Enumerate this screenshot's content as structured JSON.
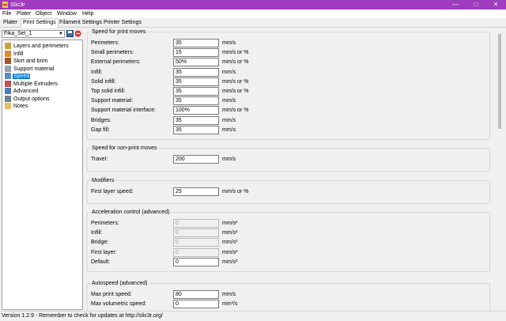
{
  "window": {
    "title": "Slic3r"
  },
  "menu": [
    "File",
    "Plater",
    "Object",
    "Window",
    "Help"
  ],
  "tabs": [
    "Plater",
    "Print Settings",
    "Filament Settings",
    "Printer Settings"
  ],
  "active_tab": 1,
  "preset": "Fika_Set_1",
  "tree": [
    {
      "label": "Layers and perimeters",
      "icon": "layers-icon",
      "color": "#c8a040"
    },
    {
      "label": "Infill",
      "icon": "infill-icon",
      "color": "#e08a30"
    },
    {
      "label": "Skirt and brim",
      "icon": "skirt-brim-icon",
      "color": "#a05a2a"
    },
    {
      "label": "Support material",
      "icon": "support-material-icon",
      "color": "#9aa0a8"
    },
    {
      "label": "Speed",
      "icon": "speed-gauge-icon",
      "color": "#5a8ac8",
      "selected": true
    },
    {
      "label": "Multiple Extruders",
      "icon": "funnel-icon",
      "color": "#c05050"
    },
    {
      "label": "Advanced",
      "icon": "wrench-icon",
      "color": "#4a7ac0"
    },
    {
      "label": "Output options",
      "icon": "gears-icon",
      "color": "#708090"
    },
    {
      "label": "Notes",
      "icon": "note-icon",
      "color": "#e0c060"
    }
  ],
  "groups": [
    {
      "title": "Speed for print moves",
      "rows": [
        {
          "label": "Perimeters:",
          "value": "35",
          "unit": "mm/s"
        },
        {
          "label": "Small perimeters:",
          "value": "15",
          "unit": "mm/s or %"
        },
        {
          "label": "External perimeters:",
          "value": "50%",
          "unit": "mm/s or %"
        },
        {
          "label": "Infill:",
          "value": "35",
          "unit": "mm/s"
        },
        {
          "label": "Solid infill:",
          "value": "35",
          "unit": "mm/s or %"
        },
        {
          "label": "Top solid infill:",
          "value": "35",
          "unit": "mm/s or %"
        },
        {
          "label": "Support material:",
          "value": "35",
          "unit": "mm/s"
        },
        {
          "label": "Support material interface:",
          "value": "100%",
          "unit": "mm/s or %"
        },
        {
          "label": "Bridges:",
          "value": "35",
          "unit": "mm/s"
        },
        {
          "label": "Gap fill:",
          "value": "35",
          "unit": "mm/s"
        }
      ]
    },
    {
      "title": "Speed for non-print moves",
      "rows": [
        {
          "label": "Travel:",
          "value": "200",
          "unit": "mm/s"
        }
      ]
    },
    {
      "title": "Modifiers",
      "rows": [
        {
          "label": "First layer speed:",
          "value": "25",
          "unit": "mm/s or %"
        }
      ]
    },
    {
      "title": "Acceleration control (advanced)",
      "rows": [
        {
          "label": "Perimeters:",
          "value": "0",
          "unit": "mm/s²",
          "disabled": true
        },
        {
          "label": "Infill:",
          "value": "0",
          "unit": "mm/s²",
          "disabled": true
        },
        {
          "label": "Bridge:",
          "value": "0",
          "unit": "mm/s²",
          "disabled": true
        },
        {
          "label": "First layer:",
          "value": "0",
          "unit": "mm/s²",
          "disabled": true
        },
        {
          "label": "Default:",
          "value": "0",
          "unit": "mm/s²"
        }
      ]
    },
    {
      "title": "Autospeed (advanced)",
      "rows": [
        {
          "label": "Max print speed:",
          "value": "80",
          "unit": "mm/s"
        },
        {
          "label": "Max volumetric speed:",
          "value": "0",
          "unit": "mm³/s"
        }
      ]
    }
  ],
  "status": "Version 1.2.9 - Remember to check for updates at http://slic3r.org/",
  "colors": {
    "titlebar": "#a03cbe",
    "selection": "#0078d7"
  }
}
